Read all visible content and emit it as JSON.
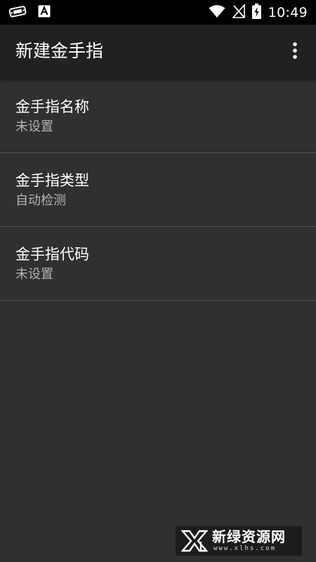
{
  "status_bar": {
    "time": "10:49",
    "left_icons": [
      "gamepad-icon",
      "text-a-icon"
    ],
    "right_icons": [
      "wifi-icon",
      "no-signal-icon",
      "battery-charging-icon"
    ]
  },
  "app_bar": {
    "title": "新建金手指",
    "overflow_icon": "more-vert-icon"
  },
  "preferences": [
    {
      "title": "金手指名称",
      "summary": "未设置"
    },
    {
      "title": "金手指类型",
      "summary": "自动检测"
    },
    {
      "title": "金手指代码",
      "summary": "未设置"
    }
  ],
  "watermark": {
    "name": "新绿资源网",
    "domain": "www.xlhs.com"
  },
  "colors": {
    "background": "#303030",
    "app_bar": "#212121",
    "status_bar": "#000000",
    "divider": "#4f4f4f",
    "primary_text": "#ffffff",
    "secondary_text": "#b3b3b3"
  }
}
